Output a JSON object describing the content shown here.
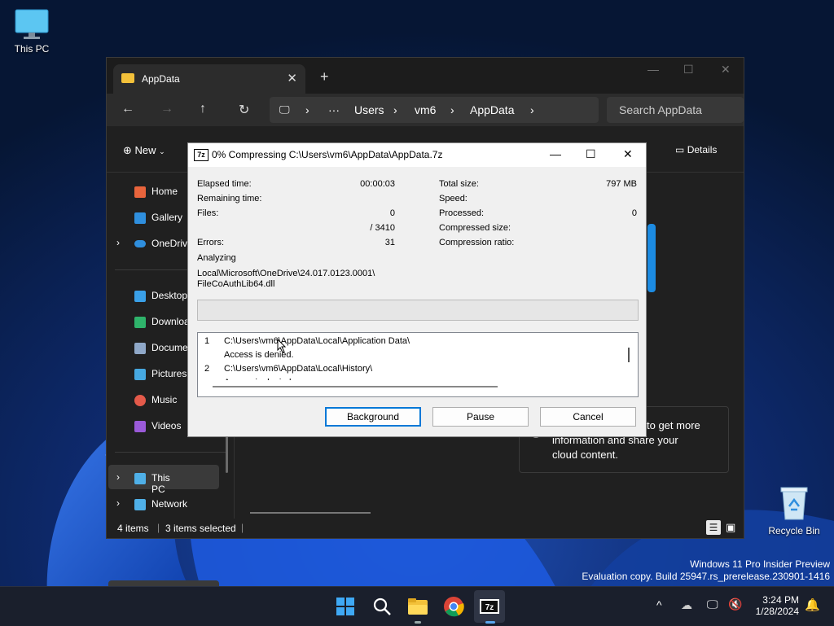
{
  "desktop": {
    "icons": [
      {
        "label": "This PC",
        "icon": "computer-icon"
      },
      {
        "label": "Recycle Bin",
        "icon": "recycle-bin-icon"
      }
    ],
    "watermark": [
      "Windows 11 Pro Insider Preview",
      "Evaluation copy. Build 25947.rs_prerelease.230901-1416"
    ]
  },
  "explorer": {
    "tab_title": "AppData",
    "tab_close": "✕",
    "new_tab": "+",
    "breadcrumb": [
      "Users",
      "vm6",
      "AppData"
    ],
    "breadcrumb_more": "···",
    "search_placeholder": "Search AppData",
    "new_button": "New",
    "details_button": "Details",
    "sidebar": [
      {
        "label": "Home",
        "icon": "home-icon",
        "color": "#e8643c"
      },
      {
        "label": "Gallery",
        "icon": "gallery-icon",
        "color": "#2f8fde"
      },
      {
        "label": "OneDrive",
        "icon": "onedrive-icon",
        "color": "#2f8fde"
      },
      {
        "label": "Desktop",
        "icon": "desktop-icon",
        "color": "#3aa0e8"
      },
      {
        "label": "Downloads",
        "icon": "download-icon",
        "color": "#2fb36b"
      },
      {
        "label": "Documents",
        "icon": "documents-icon",
        "color": "#8fa8c8"
      },
      {
        "label": "Pictures",
        "icon": "pictures-icon",
        "color": "#46a8e0"
      },
      {
        "label": "Music",
        "icon": "music-icon",
        "color": "#e45a4a"
      },
      {
        "label": "Videos",
        "icon": "videos-icon",
        "color": "#9a5ad8"
      },
      {
        "label": "This PC",
        "icon": "this-pc-icon",
        "color": "#4fb0e8"
      },
      {
        "label": "Network",
        "icon": "network-icon",
        "color": "#4fb0e8"
      }
    ],
    "info_card_text": [
      "to get more",
      "information and share your",
      "cloud content."
    ],
    "status": {
      "items": "4 items",
      "selected": "3 items selected"
    }
  },
  "dialog": {
    "title": "0% Compressing C:\\Users\\vm6\\AppData\\AppData.7z",
    "logo": "7z",
    "stats_left": [
      {
        "label": "Elapsed time:",
        "value": "00:00:03"
      },
      {
        "label": "Remaining time:",
        "value": ""
      },
      {
        "label": "Files:",
        "value": "0"
      },
      {
        "label": "",
        "value": "/ 3410"
      },
      {
        "label": "Errors:",
        "value": "31"
      }
    ],
    "stats_right": [
      {
        "label": "Total size:",
        "value": "797 MB"
      },
      {
        "label": "Speed:",
        "value": ""
      },
      {
        "label": "Processed:",
        "value": "0"
      },
      {
        "label": "Compressed size:",
        "value": ""
      },
      {
        "label": "Compression ratio:",
        "value": ""
      }
    ],
    "status_text": "Analyzing",
    "current_file": [
      "Local\\Microsoft\\OneDrive\\24.017.0123.0001\\",
      "FileCoAuthLib64.dll"
    ],
    "progress": 0,
    "errors": [
      {
        "num": "1",
        "path": "C:\\Users\\vm6\\AppData\\Local\\Application Data\\",
        "msg": "Access is denied."
      },
      {
        "num": "2",
        "path": "C:\\Users\\vm6\\AppData\\Local\\History\\",
        "msg": "Access is denied."
      }
    ],
    "buttons": {
      "background": "Background",
      "pause": "Pause",
      "cancel": "Cancel"
    }
  },
  "taskbar": {
    "apps": [
      "start-icon",
      "search-icon",
      "file-explorer-icon",
      "chrome-icon",
      "7zip-icon"
    ],
    "time": "3:24 PM",
    "date": "1/28/2024"
  }
}
